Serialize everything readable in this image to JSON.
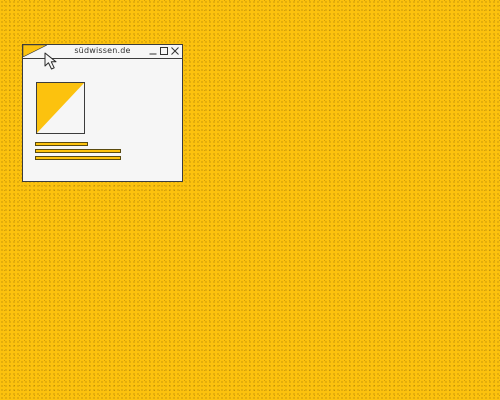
{
  "window": {
    "title": "südwissen.de",
    "controls": [
      "minimize-icon",
      "maximize-icon",
      "close-icon"
    ]
  },
  "content": {
    "image": "placeholder-image",
    "text_lines": 3
  },
  "colors": {
    "background": "#fcc20e",
    "window": "#f6f6f6",
    "border": "#3c3c3c"
  }
}
